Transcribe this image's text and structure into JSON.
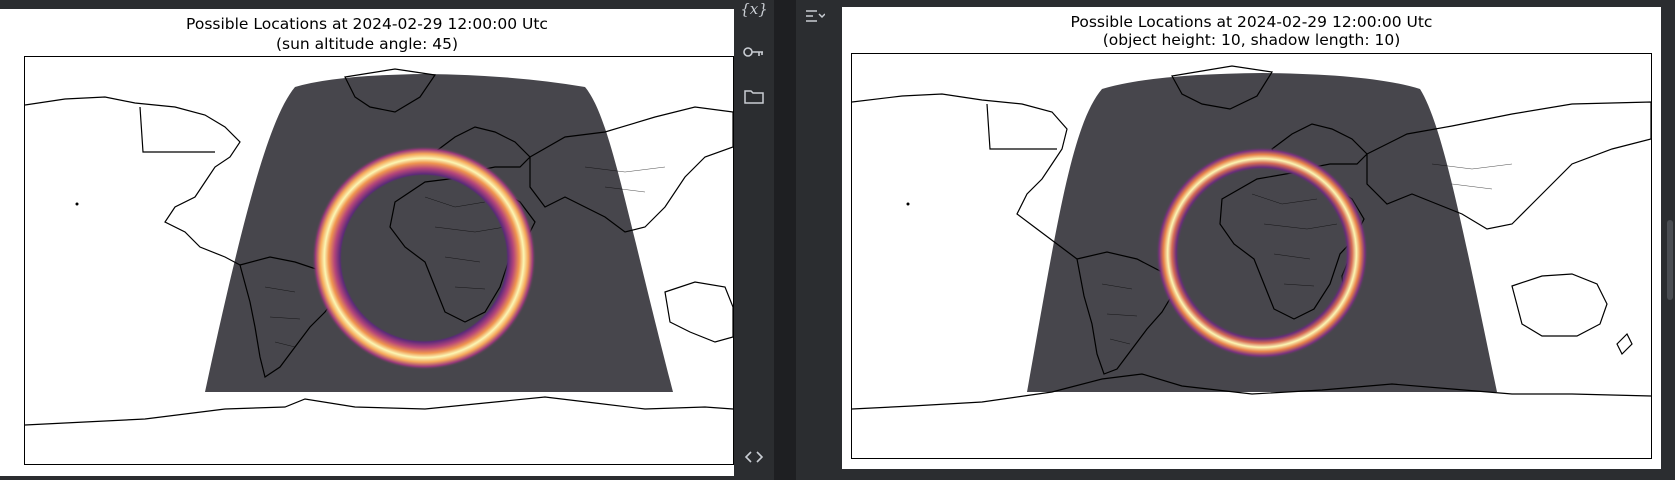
{
  "left_plot": {
    "title_line1": "Possible Locations at 2024-02-29 12:00:00 Utc",
    "title_line2": "(sun altitude angle: 45)"
  },
  "right_plot": {
    "title_line1": "Possible Locations at 2024-02-29 12:00:00 Utc",
    "title_line2": "(object height: 10, shadow length: 10)"
  },
  "toolbar": {
    "icons": [
      "variables-icon",
      "key-icon",
      "folder-icon",
      "code-icon",
      "collapse-icon"
    ]
  },
  "colors": {
    "dark_shade": "#47464c",
    "ring_outer": "#5c2a7a",
    "ring_mid": "#e8834a",
    "ring_core": "#fbf6b4",
    "background": "#2b2d30"
  }
}
